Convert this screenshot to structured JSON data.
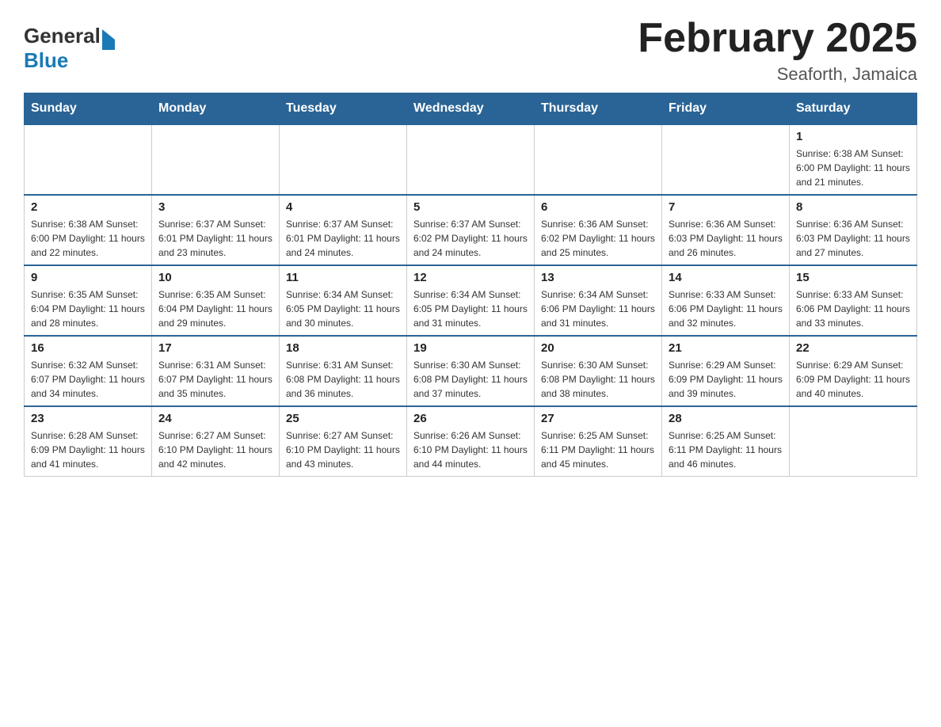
{
  "header": {
    "logo_general": "General",
    "logo_blue": "Blue",
    "month_title": "February 2025",
    "location": "Seaforth, Jamaica"
  },
  "days_of_week": [
    "Sunday",
    "Monday",
    "Tuesday",
    "Wednesday",
    "Thursday",
    "Friday",
    "Saturday"
  ],
  "weeks": [
    [
      {
        "day": "",
        "info": ""
      },
      {
        "day": "",
        "info": ""
      },
      {
        "day": "",
        "info": ""
      },
      {
        "day": "",
        "info": ""
      },
      {
        "day": "",
        "info": ""
      },
      {
        "day": "",
        "info": ""
      },
      {
        "day": "1",
        "info": "Sunrise: 6:38 AM\nSunset: 6:00 PM\nDaylight: 11 hours\nand 21 minutes."
      }
    ],
    [
      {
        "day": "2",
        "info": "Sunrise: 6:38 AM\nSunset: 6:00 PM\nDaylight: 11 hours\nand 22 minutes."
      },
      {
        "day": "3",
        "info": "Sunrise: 6:37 AM\nSunset: 6:01 PM\nDaylight: 11 hours\nand 23 minutes."
      },
      {
        "day": "4",
        "info": "Sunrise: 6:37 AM\nSunset: 6:01 PM\nDaylight: 11 hours\nand 24 minutes."
      },
      {
        "day": "5",
        "info": "Sunrise: 6:37 AM\nSunset: 6:02 PM\nDaylight: 11 hours\nand 24 minutes."
      },
      {
        "day": "6",
        "info": "Sunrise: 6:36 AM\nSunset: 6:02 PM\nDaylight: 11 hours\nand 25 minutes."
      },
      {
        "day": "7",
        "info": "Sunrise: 6:36 AM\nSunset: 6:03 PM\nDaylight: 11 hours\nand 26 minutes."
      },
      {
        "day": "8",
        "info": "Sunrise: 6:36 AM\nSunset: 6:03 PM\nDaylight: 11 hours\nand 27 minutes."
      }
    ],
    [
      {
        "day": "9",
        "info": "Sunrise: 6:35 AM\nSunset: 6:04 PM\nDaylight: 11 hours\nand 28 minutes."
      },
      {
        "day": "10",
        "info": "Sunrise: 6:35 AM\nSunset: 6:04 PM\nDaylight: 11 hours\nand 29 minutes."
      },
      {
        "day": "11",
        "info": "Sunrise: 6:34 AM\nSunset: 6:05 PM\nDaylight: 11 hours\nand 30 minutes."
      },
      {
        "day": "12",
        "info": "Sunrise: 6:34 AM\nSunset: 6:05 PM\nDaylight: 11 hours\nand 31 minutes."
      },
      {
        "day": "13",
        "info": "Sunrise: 6:34 AM\nSunset: 6:06 PM\nDaylight: 11 hours\nand 31 minutes."
      },
      {
        "day": "14",
        "info": "Sunrise: 6:33 AM\nSunset: 6:06 PM\nDaylight: 11 hours\nand 32 minutes."
      },
      {
        "day": "15",
        "info": "Sunrise: 6:33 AM\nSunset: 6:06 PM\nDaylight: 11 hours\nand 33 minutes."
      }
    ],
    [
      {
        "day": "16",
        "info": "Sunrise: 6:32 AM\nSunset: 6:07 PM\nDaylight: 11 hours\nand 34 minutes."
      },
      {
        "day": "17",
        "info": "Sunrise: 6:31 AM\nSunset: 6:07 PM\nDaylight: 11 hours\nand 35 minutes."
      },
      {
        "day": "18",
        "info": "Sunrise: 6:31 AM\nSunset: 6:08 PM\nDaylight: 11 hours\nand 36 minutes."
      },
      {
        "day": "19",
        "info": "Sunrise: 6:30 AM\nSunset: 6:08 PM\nDaylight: 11 hours\nand 37 minutes."
      },
      {
        "day": "20",
        "info": "Sunrise: 6:30 AM\nSunset: 6:08 PM\nDaylight: 11 hours\nand 38 minutes."
      },
      {
        "day": "21",
        "info": "Sunrise: 6:29 AM\nSunset: 6:09 PM\nDaylight: 11 hours\nand 39 minutes."
      },
      {
        "day": "22",
        "info": "Sunrise: 6:29 AM\nSunset: 6:09 PM\nDaylight: 11 hours\nand 40 minutes."
      }
    ],
    [
      {
        "day": "23",
        "info": "Sunrise: 6:28 AM\nSunset: 6:09 PM\nDaylight: 11 hours\nand 41 minutes."
      },
      {
        "day": "24",
        "info": "Sunrise: 6:27 AM\nSunset: 6:10 PM\nDaylight: 11 hours\nand 42 minutes."
      },
      {
        "day": "25",
        "info": "Sunrise: 6:27 AM\nSunset: 6:10 PM\nDaylight: 11 hours\nand 43 minutes."
      },
      {
        "day": "26",
        "info": "Sunrise: 6:26 AM\nSunset: 6:10 PM\nDaylight: 11 hours\nand 44 minutes."
      },
      {
        "day": "27",
        "info": "Sunrise: 6:25 AM\nSunset: 6:11 PM\nDaylight: 11 hours\nand 45 minutes."
      },
      {
        "day": "28",
        "info": "Sunrise: 6:25 AM\nSunset: 6:11 PM\nDaylight: 11 hours\nand 46 minutes."
      },
      {
        "day": "",
        "info": ""
      }
    ]
  ]
}
